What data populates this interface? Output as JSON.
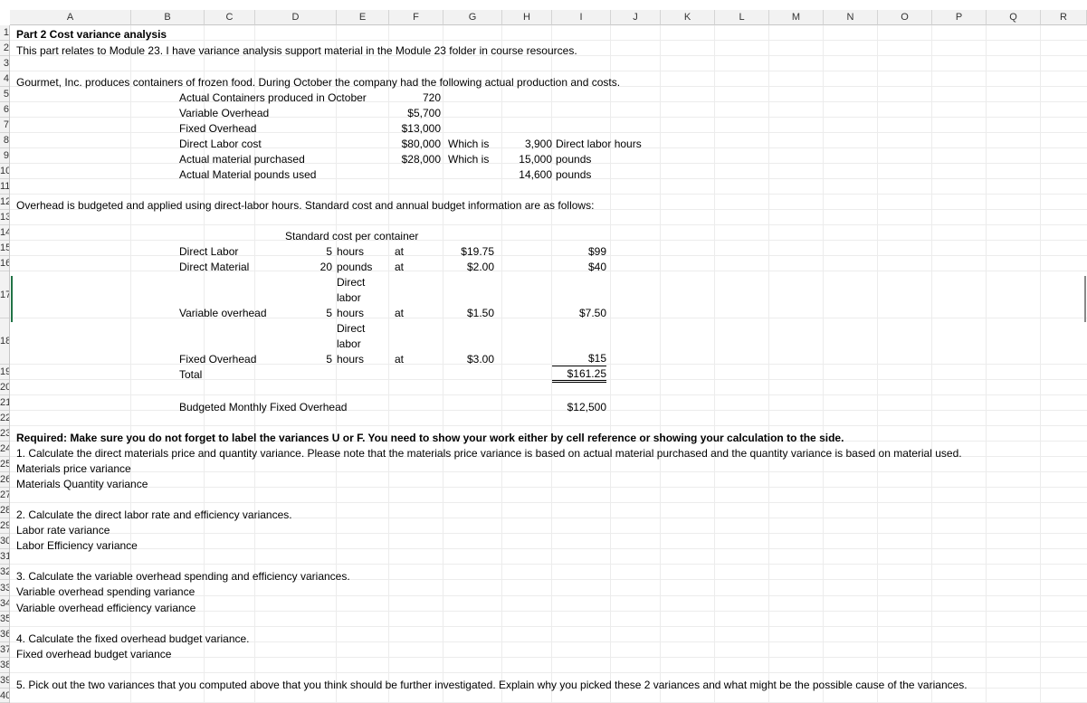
{
  "columns": [
    "A",
    "B",
    "C",
    "D",
    "E",
    "F",
    "G",
    "H",
    "I",
    "J",
    "K",
    "L",
    "M",
    "N",
    "O",
    "P",
    "Q",
    "R"
  ],
  "rows": [
    "1",
    "2",
    "3",
    "4",
    "5",
    "6",
    "7",
    "8",
    "9",
    "10",
    "11",
    "12",
    "13",
    "14",
    "15",
    "16",
    "17",
    "18",
    "19",
    "20",
    "21",
    "22",
    "23",
    "24",
    "25",
    "26",
    "27",
    "28",
    "29",
    "30",
    "31",
    "32",
    "33",
    "34",
    "35",
    "36",
    "37",
    "38",
    "39",
    "40"
  ],
  "text": {
    "title": "Part 2 Cost variance analysis",
    "intro": "This part relates to Module 23.  I have  variance analysis support material in the Module 23 folder in course resources.",
    "company": "Gourmet, Inc. produces containers of frozen food.  During October the company had the following actual production and costs.",
    "lbl_containers": "Actual Containers produced in October",
    "val_containers": "720",
    "lbl_var_oh": "Variable Overhead",
    "val_var_oh": "$5,700",
    "lbl_fixed_oh": "Fixed Overhead",
    "val_fixed_oh": "$13,000",
    "lbl_dl_cost": "Direct Labor cost",
    "val_dl_cost": "$80,000",
    "which_is_1": "Which is",
    "dl_hours_val": "3,900",
    "dl_hours_lbl": "Direct labor hours",
    "lbl_mat_purch": "Actual material purchased",
    "val_mat_purch": "$28,000",
    "which_is_2": "Which is",
    "mat_purch_qty": "15,000",
    "mat_purch_unit": "pounds",
    "lbl_mat_used": "Actual Material pounds used",
    "mat_used_qty": "14,600",
    "mat_used_unit": "pounds",
    "overhead_note": "Overhead is budgeted and applied using direct-labor hours.  Standard cost and annual budget information are as follows:",
    "std_header": "Standard cost per container",
    "dl_label": "Direct Labor",
    "dl_qty": "5",
    "dl_unit": "hours",
    "dl_at": "at",
    "dl_rate": "$19.75",
    "dl_total": "$99",
    "dm_label": "Direct Material",
    "dm_qty": "20",
    "dm_unit": "pounds",
    "dm_at": "at",
    "dm_rate": "$2.00",
    "dm_total": "$40",
    "vo_unit_l1": "Direct",
    "vo_unit_l2": "labor",
    "vo_label": "Variable overhead",
    "vo_qty": "5",
    "vo_unit_l3": "hours",
    "vo_at": "at",
    "vo_rate": "$1.50",
    "vo_total": "$7.50",
    "fo_unit_l1": "Direct",
    "fo_unit_l2": "labor",
    "fo_label": "Fixed Overhead",
    "fo_qty": "5",
    "fo_unit_l3": "hours",
    "fo_at": "at",
    "fo_rate": "$3.00",
    "fo_total": "$15",
    "total_label": "Total",
    "total_val": "$161.25",
    "budget_label": "Budgeted Monthly Fixed Overhead",
    "budget_val": "$12,500",
    "required": "Required:  Make sure you do not forget to label the variances U or F.  You need to show your work either by cell reference or showing your calculation to the side.",
    "q1": "1.  Calculate the  direct materials price and quantity variance.  Please note that the materials price variance is based on actual material purchased and the quantity variance is based on material used.",
    "q1a": "Materials price variance",
    "q1b": "Materials Quantity variance",
    "q2": "2.  Calculate the direct labor rate and efficiency variances.",
    "q2a": "Labor rate variance",
    "q2b": "Labor Efficiency variance",
    "q3": "3.  Calculate the variable overhead spending and efficiency variances.",
    "q3a": "Variable overhead spending variance",
    "q3b": "Variable overhead efficiency variance",
    "q4": "4.  Calculate the fixed overhead budget variance.",
    "q4a": "Fixed overhead budget variance",
    "q5": "5.  Pick out the two variances that you computed above that you think should be further investigated.  Explain why you picked these 2 variances and what might be the possible cause of the variances."
  }
}
